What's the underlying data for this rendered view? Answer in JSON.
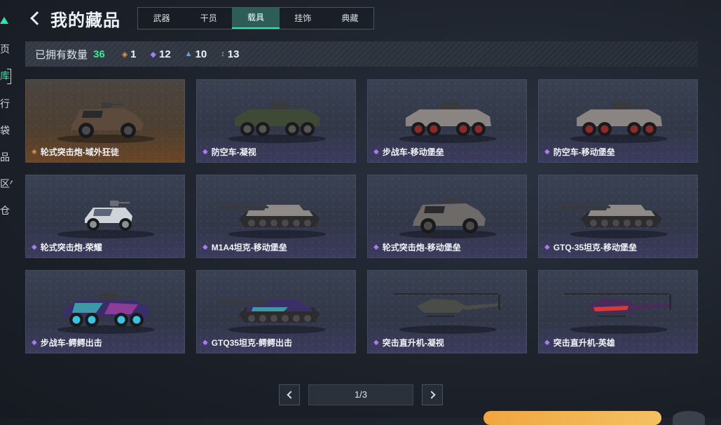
{
  "sidebar": {
    "items": [
      {
        "label": "页",
        "active": false
      },
      {
        "label": "库",
        "active": true
      },
      {
        "label": "行",
        "active": false
      },
      {
        "label": "袋",
        "active": false
      },
      {
        "label": "品",
        "active": false
      },
      {
        "label": "区^",
        "active": false
      },
      {
        "label": "仓",
        "active": false
      }
    ]
  },
  "header": {
    "title": "我的藏品"
  },
  "tabs": [
    {
      "label": "武器",
      "active": false
    },
    {
      "label": "干员",
      "active": false
    },
    {
      "label": "载具",
      "active": true
    },
    {
      "label": "挂饰",
      "active": false
    },
    {
      "label": "典藏",
      "active": false
    }
  ],
  "stats": {
    "owned_label": "已拥有数量",
    "owned_count": "36",
    "rarities": [
      {
        "icon": "gold-diamond-icon",
        "glyph": "◈",
        "color": "#e8964a",
        "value": "1"
      },
      {
        "icon": "purple-diamond-icon",
        "glyph": "◆",
        "color": "#a67cf0",
        "value": "12"
      },
      {
        "icon": "blue-chevron-icon",
        "glyph": "▲",
        "color": "#5aa2f0",
        "value": "10"
      },
      {
        "icon": "green-arrows-icon",
        "glyph": "↕",
        "color": "#3fe0b0",
        "value": "13"
      }
    ]
  },
  "cards": [
    {
      "name": "轮式突击炮-域外狂徒",
      "rarity": "gold",
      "vehicle": "armored-car"
    },
    {
      "name": "防空车-凝视",
      "rarity": "purple",
      "vehicle": "ifv-green"
    },
    {
      "name": "步战车-移动堡垒",
      "rarity": "purple",
      "vehicle": "ifv-red"
    },
    {
      "name": "防空车-移动堡垒",
      "rarity": "purple",
      "vehicle": "ifv-red"
    },
    {
      "name": "轮式突击炮-荣耀",
      "rarity": "purple",
      "vehicle": "buggy"
    },
    {
      "name": "M1A4坦克-移动堡垒",
      "rarity": "purple",
      "vehicle": "tank"
    },
    {
      "name": "轮式突击炮-移动堡垒",
      "rarity": "purple",
      "vehicle": "armored-car-light"
    },
    {
      "name": "GTQ-35坦克-移动堡垒",
      "rarity": "purple",
      "vehicle": "tank"
    },
    {
      "name": "步战车-鳄鳄出击",
      "rarity": "purple",
      "vehicle": "ifv-neon"
    },
    {
      "name": "GTQ35坦克-鳄鳄出击",
      "rarity": "purple",
      "vehicle": "tank-neon"
    },
    {
      "name": "突击直升机-凝视",
      "rarity": "purple",
      "vehicle": "heli-dark"
    },
    {
      "name": "突击直升机-英雄",
      "rarity": "purple",
      "vehicle": "heli-red"
    }
  ],
  "pagination": {
    "indicator": "1/3"
  },
  "colors": {
    "accent_green": "#3fe68f",
    "tab_active": "#2c5d57",
    "gold_rarity": "#e8964a",
    "purple_rarity": "#a67cf0"
  }
}
